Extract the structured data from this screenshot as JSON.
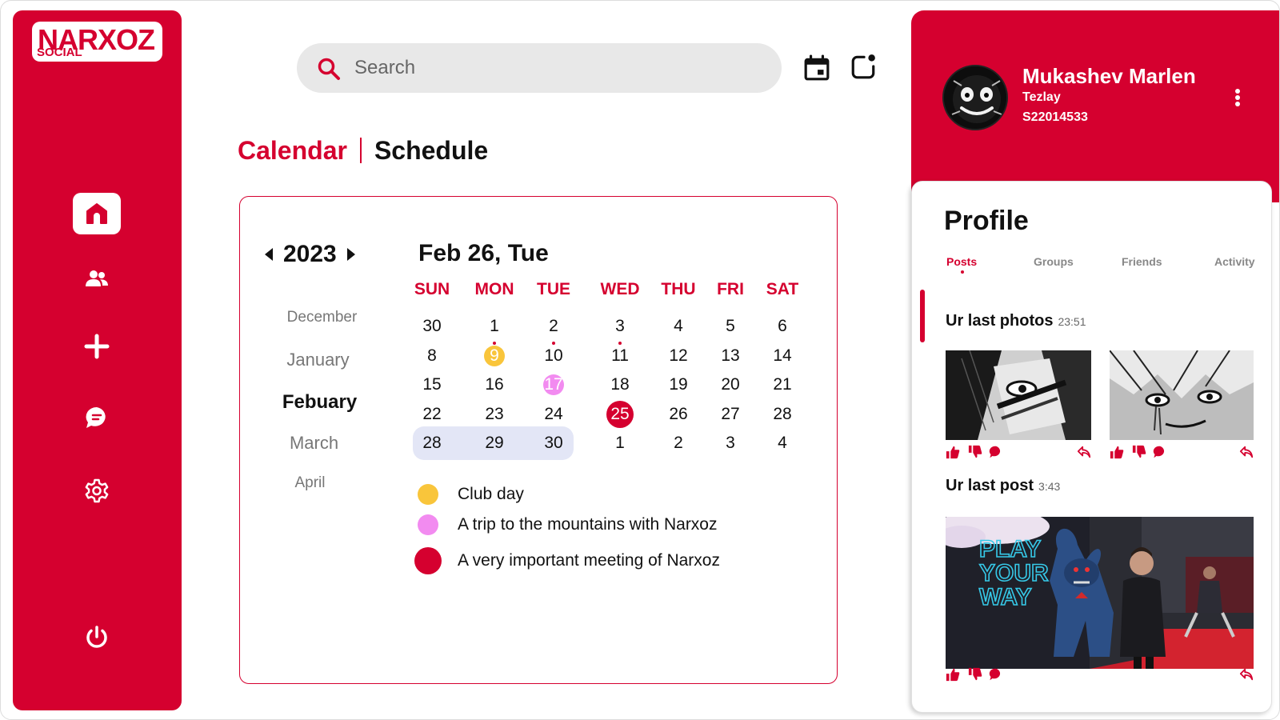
{
  "brand": {
    "name": "NARXOZ",
    "sub": "SOCIAL"
  },
  "colors": {
    "accent": "#D5002F",
    "club_day": "#F9C53B",
    "trip": "#F28BF0",
    "meeting": "#D5002F",
    "week_highlight": "#E3E6F6"
  },
  "sidebar": {
    "items": [
      {
        "icon": "home-icon",
        "active": true
      },
      {
        "icon": "friends-icon",
        "active": false
      },
      {
        "icon": "plus-icon",
        "active": false
      },
      {
        "icon": "chat-icon",
        "active": false
      },
      {
        "icon": "settings-icon",
        "active": false
      },
      {
        "icon": "power-icon",
        "active": false
      }
    ]
  },
  "search": {
    "placeholder": "Search"
  },
  "page": {
    "tab_active": "Calendar",
    "tab_other": "Schedule"
  },
  "calendar": {
    "year": "2023",
    "months": [
      "December",
      "January",
      "Febuary",
      "March",
      "April"
    ],
    "active_month": "Febuary",
    "date_title": "Feb 26, Tue",
    "weekdays": [
      "SUN",
      "MON",
      "TUE",
      "WED",
      "THU",
      "FRI",
      "SAT"
    ],
    "weeks": [
      [
        "30",
        "1",
        "2",
        "3",
        "4",
        "5",
        "6"
      ],
      [
        "8",
        "9",
        "10",
        "11",
        "12",
        "13",
        "14"
      ],
      [
        "15",
        "16",
        "17",
        "18",
        "19",
        "20",
        "21"
      ],
      [
        "22",
        "23",
        "24",
        "25",
        "26",
        "27",
        "28"
      ],
      [
        "28",
        "29",
        "30",
        "1",
        "2",
        "3",
        "4"
      ]
    ],
    "events": [
      {
        "day": "9",
        "type": "club_day"
      },
      {
        "day": "17",
        "type": "trip"
      },
      {
        "day": "25",
        "type": "meeting"
      }
    ],
    "dotted_days": [
      "1",
      "2",
      "3"
    ],
    "highlighted_week": 4,
    "legend": [
      {
        "label": "Club day",
        "type": "club_day"
      },
      {
        "label": "A trip to the mountains with Narxoz",
        "type": "trip"
      },
      {
        "label": "A very important meeting of Narxoz",
        "type": "meeting"
      }
    ]
  },
  "user": {
    "name": "Mukashev Marlen",
    "nickname": "Tezlay",
    "id": "S22014533"
  },
  "profile": {
    "title": "Profile",
    "tabs": [
      "Posts",
      "Groups",
      "Friends",
      "Activity"
    ],
    "active_tab": "Posts",
    "photos_section": {
      "title": "Ur last photos",
      "time": "23:51"
    },
    "post_section": {
      "title": "Ur last post",
      "time": "3:43"
    }
  }
}
